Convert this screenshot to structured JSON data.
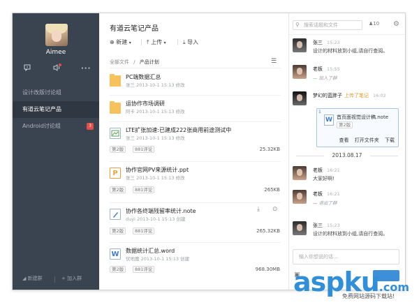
{
  "sidebar": {
    "username": "Aimee",
    "groups": [
      {
        "label": "设计改版讨论组",
        "active": false,
        "badge": ""
      },
      {
        "label": "有道云笔记产品",
        "active": true,
        "badge": ""
      },
      {
        "label": "Android讨论组",
        "active": false,
        "badge": "3"
      }
    ],
    "footer": {
      "new_group": "新建群",
      "join_group": "加入群"
    }
  },
  "files": {
    "title": "有道云笔记产品",
    "toolbar": {
      "new": "新建",
      "upload": "上传",
      "import": "导入"
    },
    "breadcrumb": {
      "root": "全部文件",
      "sep": "/",
      "current": "产品计划"
    },
    "items": [
      {
        "name": "PC端数据汇总",
        "meta": "张三  2013-10-1 15:13  修改",
        "type": "folder",
        "tags": [],
        "size": ""
      },
      {
        "name": "运协作市场调研",
        "meta": "阿卡  2013-10-1 15:13  修改",
        "type": "folder",
        "tags": [],
        "size": ""
      },
      {
        "name": "LTE扩张加速:已建成222张商用前途测试中",
        "meta": "张三  2013-10-1 15:13  修改",
        "type": "image",
        "tags": [
          "第2版",
          "881评论"
        ],
        "size": "25.32KB"
      },
      {
        "name": "协作官网PV来源统计.ppt",
        "meta": "张三  2013-10-1 15:13  修改",
        "type": "ppt",
        "tags": [
          "第2版",
          "881评论"
        ],
        "size": "265KB"
      },
      {
        "name": "协作各终端残留率统计.note",
        "meta": "duyi  2013-10-1 15:13  创建",
        "type": "note",
        "tags": [
          "第2版",
          "881评论"
        ],
        "size": "265.32KB"
      },
      {
        "name": "数据统计汇总.word",
        "meta": "伏地魔  2013-10-1 15:13  创建",
        "type": "word",
        "tags": [
          "第2版",
          "881评论"
        ],
        "size": "968.30MB"
      }
    ]
  },
  "chat": {
    "search_placeholder": "搜索话题和文件",
    "people_count": "10",
    "messages": [
      {
        "name": "张三",
        "time": "15:23",
        "text": "设计的材料放到小组,请自行查阅。",
        "kind": "text"
      },
      {
        "name": "老板",
        "time": "15:55",
        "text": "加入了群",
        "kind": "join"
      },
      {
        "name": "梦幻的蓝胖子",
        "action": "上传了笔记",
        "time": "16:02",
        "kind": "upload"
      },
      {
        "name": "老板",
        "time": "16:21",
        "text": "大家好啊!",
        "kind": "text"
      },
      {
        "name": "老板",
        "time": "16:21",
        "text": "退出了群",
        "kind": "leave"
      },
      {
        "name": "张三",
        "time": "15:23",
        "text": "设计的材料放到小组,请自行查阅。",
        "kind": "text"
      }
    ],
    "file_card": {
      "count": "1",
      "name": "首页面视觉设计稿.note",
      "tag": "第2版",
      "actions": [
        "查看",
        "打开文件夹",
        "下载"
      ]
    },
    "date_separator": "2013.08.17",
    "input_placeholder": "输入你想说的话...",
    "send_label": ""
  },
  "watermark": {
    "brand_main": "aspku",
    "brand_suffix": ".com",
    "subtitle": "免费网站源码下载站!"
  },
  "colors": {
    "sidebar": "#3a4350",
    "accent": "#3d8fd9",
    "badge": "#e0504b",
    "folder": "#f7c15b"
  }
}
